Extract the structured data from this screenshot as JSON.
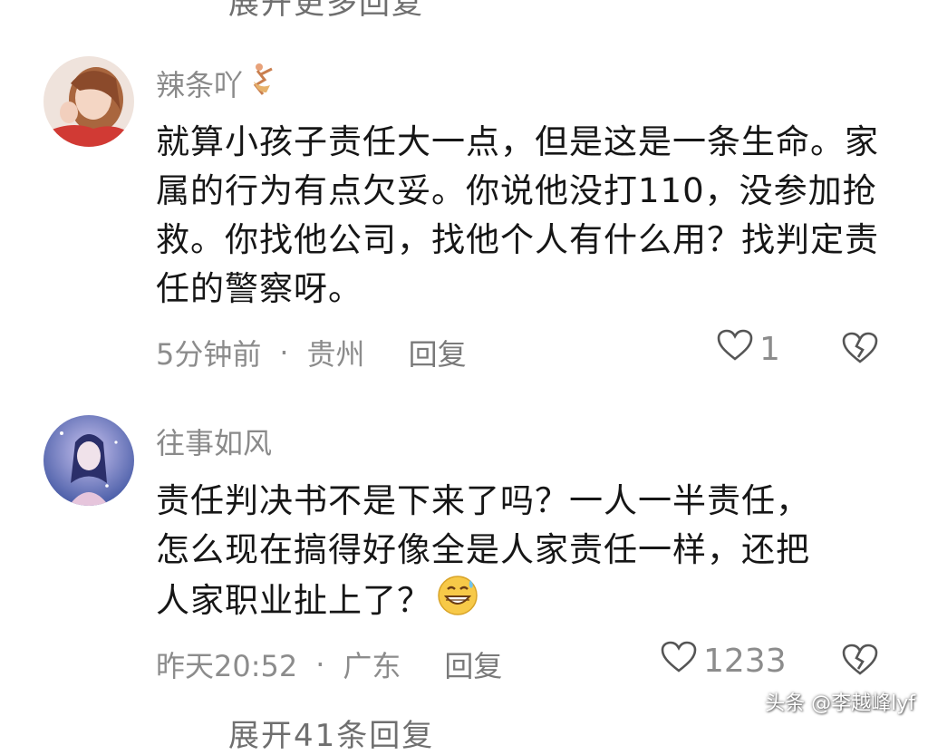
{
  "top_cutoff_text": "展开更多回复",
  "comments": [
    {
      "username": "辣条吖",
      "user_badge_icon": "dancer-icon",
      "text": "就算小孩子责任大一点，但是这是一条生命。家属的行为有点欠妥。你说他没打110，没参加抢救。你找他公司，找他个人有什么用？找判定责任的警察呀。",
      "time": "5分钟前",
      "separator": "·",
      "location": "贵州",
      "reply_label": "回复",
      "like_count": "1"
    },
    {
      "username": "往事如风",
      "text": "责任判决书不是下来了吗？一人一半责任，怎么现在搞得好像全是人家责任一样，还把人家职业扯上了？",
      "trailing_emoji": "grinning-sweat-emoji",
      "time": "昨天20:52",
      "separator": "·",
      "location": "广东",
      "reply_label": "回复",
      "like_count": "1233"
    }
  ],
  "bottom_cutoff_text": "展开41条回复",
  "watermark": "头条 @李越峰lyf"
}
